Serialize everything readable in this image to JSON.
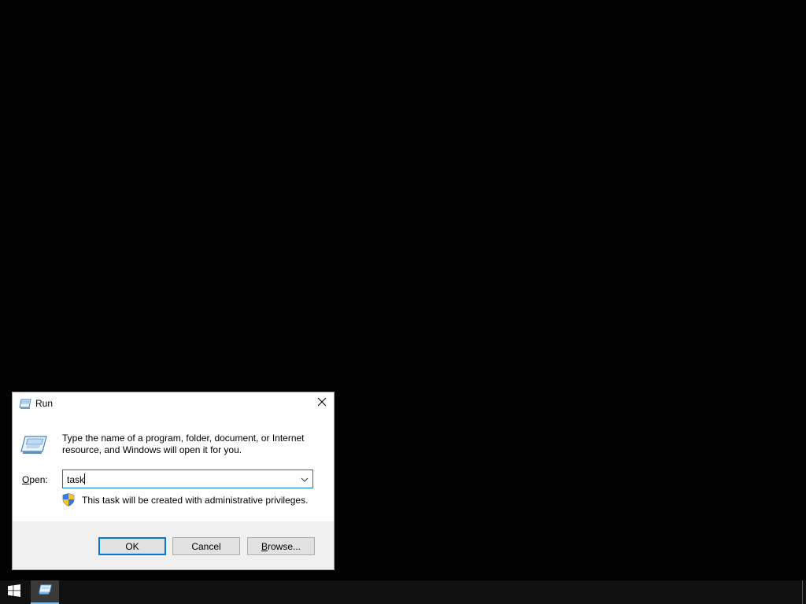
{
  "dialog": {
    "title": "Run",
    "description": "Type the name of a program, folder, document, or Internet resource, and Windows will open it for you.",
    "open_label_prefix": "",
    "open_label_underlined": "O",
    "open_label_rest": "pen:",
    "open_value": "task",
    "admin_note": "This task will be created with administrative privileges.",
    "buttons": {
      "ok": "OK",
      "cancel": "Cancel",
      "browse_underlined": "B",
      "browse_rest": "rowse..."
    }
  },
  "icons": {
    "title": "run-icon",
    "big": "run-icon",
    "close": "close-icon",
    "dropdown": "chevron-down-icon",
    "shield": "uac-shield-icon",
    "start": "windows-logo-icon",
    "taskbar_run": "run-icon"
  },
  "colors": {
    "desktop": "#000000",
    "taskbar": "#101010",
    "accent": "#0078d7",
    "footer": "#f0f0f0"
  }
}
